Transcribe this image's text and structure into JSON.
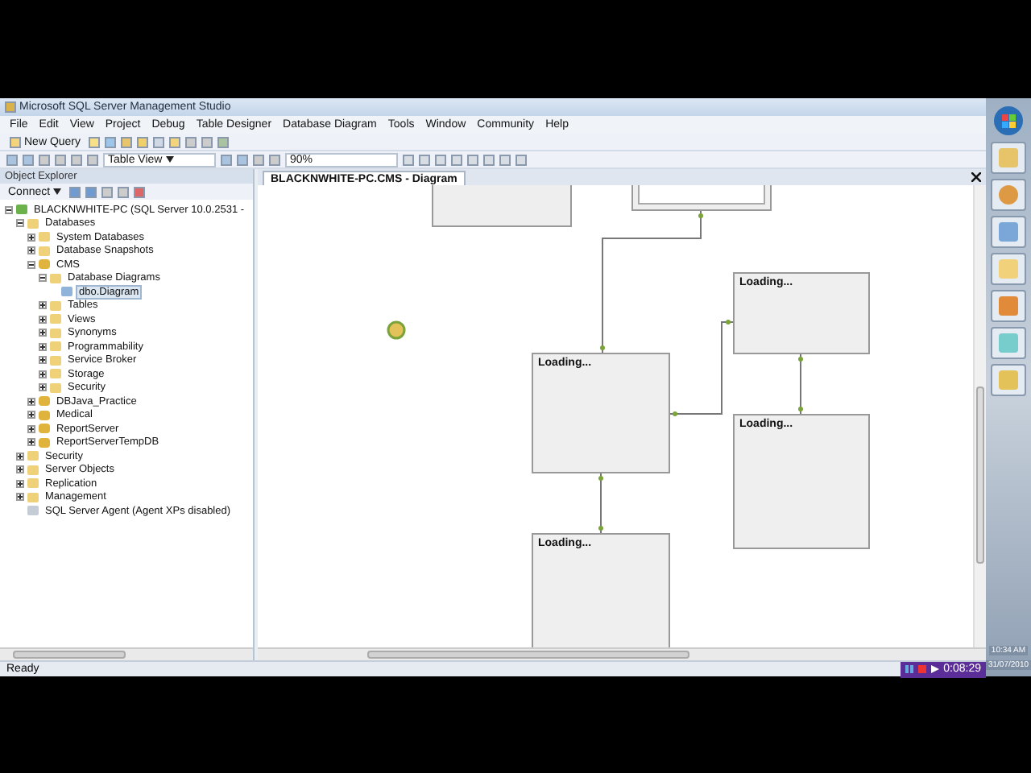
{
  "window": {
    "title": "Microsoft SQL Server Management Studio"
  },
  "menu": [
    "File",
    "Edit",
    "View",
    "Project",
    "Debug",
    "Table Designer",
    "Database Diagram",
    "Tools",
    "Window",
    "Community",
    "Help"
  ],
  "toolbar": {
    "new_query": "New Query",
    "view_dropdown": "Table View",
    "zoom": "90%"
  },
  "object_explorer": {
    "title": "Object Explorer",
    "connect": "Connect",
    "tree": [
      {
        "label": "BLACKNWHITE-PC (SQL Server 10.0.2531 -",
        "kind": "server",
        "expanded": true,
        "children": [
          {
            "label": "Databases",
            "kind": "folder",
            "expanded": true,
            "children": [
              {
                "label": "System Databases",
                "kind": "folder",
                "expanded": false
              },
              {
                "label": "Database Snapshots",
                "kind": "folder",
                "expanded": false
              },
              {
                "label": "CMS",
                "kind": "database",
                "expanded": true,
                "children": [
                  {
                    "label": "Database Diagrams",
                    "kind": "folder",
                    "expanded": true,
                    "children": [
                      {
                        "label": "dbo.Diagram",
                        "kind": "diagram",
                        "selected": true
                      }
                    ]
                  },
                  {
                    "label": "Tables",
                    "kind": "folder",
                    "expanded": false
                  },
                  {
                    "label": "Views",
                    "kind": "folder",
                    "expanded": false
                  },
                  {
                    "label": "Synonyms",
                    "kind": "folder",
                    "expanded": false
                  },
                  {
                    "label": "Programmability",
                    "kind": "folder",
                    "expanded": false
                  },
                  {
                    "label": "Service Broker",
                    "kind": "folder",
                    "expanded": false
                  },
                  {
                    "label": "Storage",
                    "kind": "folder",
                    "expanded": false
                  },
                  {
                    "label": "Security",
                    "kind": "folder",
                    "expanded": false
                  }
                ]
              },
              {
                "label": "DBJava_Practice",
                "kind": "database",
                "expanded": false
              },
              {
                "label": "Medical",
                "kind": "database",
                "expanded": false
              },
              {
                "label": "ReportServer",
                "kind": "database",
                "expanded": false
              },
              {
                "label": "ReportServerTempDB",
                "kind": "database",
                "expanded": false
              }
            ]
          },
          {
            "label": "Security",
            "kind": "folder",
            "expanded": false
          },
          {
            "label": "Server Objects",
            "kind": "folder",
            "expanded": false
          },
          {
            "label": "Replication",
            "kind": "folder",
            "expanded": false
          },
          {
            "label": "Management",
            "kind": "folder",
            "expanded": false
          },
          {
            "label": "SQL Server Agent (Agent XPs disabled)",
            "kind": "agent"
          }
        ]
      }
    ]
  },
  "document": {
    "tab": "BLACKNWHITE-PC.CMS - Diagram",
    "tables": [
      {
        "kind": "blank"
      },
      {
        "kind": "inner"
      },
      {
        "kind": "loading",
        "title": "Loading..."
      },
      {
        "kind": "loading",
        "title": "Loading..."
      },
      {
        "kind": "loading",
        "title": "Loading..."
      },
      {
        "kind": "loading",
        "title": "Loading..."
      }
    ]
  },
  "status_bar": {
    "text": "Ready",
    "recorder_time": "0:08:29"
  },
  "taskbar": {
    "time": "10:34 AM",
    "date": "31/07/2010"
  }
}
